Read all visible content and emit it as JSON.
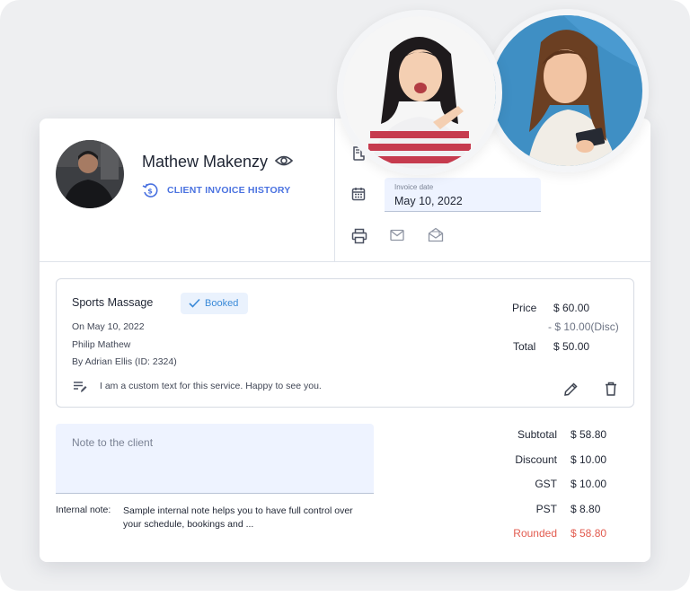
{
  "client": {
    "name": "Mathew Makenzy",
    "history_link": "CLIENT INVOICE HISTORY"
  },
  "invoice": {
    "date_label": "Invoice date",
    "date_value": "May 10, 2022"
  },
  "service": {
    "title": "Sports Massage",
    "status": "Booked",
    "date": "On May 10, 2022",
    "client": "Philip Mathew",
    "staff": "By Adrian Ellis (ID: 2324)",
    "custom_text": "I am a custom text for this service. Happy to see you.",
    "price_label": "Price",
    "price_value": "$ 60.00",
    "discount": "- $ 10.00(Disc)",
    "total_label": "Total",
    "total_value": "$ 50.00"
  },
  "notes": {
    "client_placeholder": "Note to the client",
    "internal_label": "Internal note:",
    "internal_text": "Sample internal note helps you to have full control over your schedule, bookings and ..."
  },
  "totals": [
    {
      "label": "Subtotal",
      "value": "$ 58.80"
    },
    {
      "label": "Discount",
      "value": "$ 10.00"
    },
    {
      "label": "GST",
      "value": "$ 10.00"
    },
    {
      "label": "PST",
      "value": "$ 8.80"
    },
    {
      "label": "Rounded",
      "value": "$ 58.80"
    }
  ],
  "colors": {
    "accent": "#4a72e0",
    "booked": "#3a8ad8",
    "rounded": "#e25b4f",
    "field_bg": "#eef3ff"
  },
  "icons": [
    "eye-icon",
    "history-icon",
    "receipt-icon",
    "calendar-icon",
    "print-icon",
    "mail-icon",
    "mail-open-icon",
    "check-icon",
    "notes-icon",
    "edit-icon",
    "delete-icon"
  ]
}
